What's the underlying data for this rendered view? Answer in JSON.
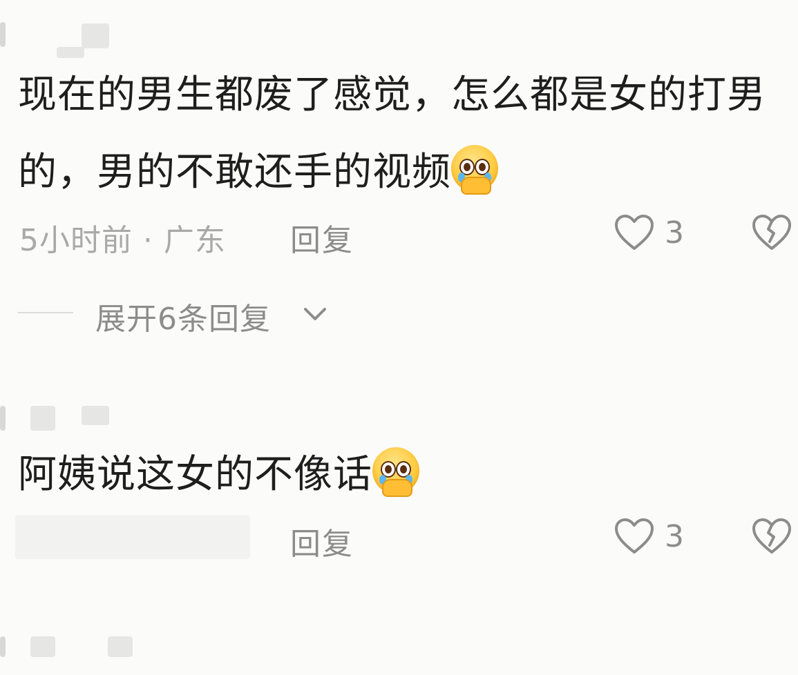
{
  "comments": [
    {
      "text": "现在的男生都废了感觉，怎么都是女的打男的，男的不敢还手的视频",
      "emoji": "pleading-crying-face",
      "time_location": "5小时前 · 广东",
      "reply_label": "回复",
      "like_count": "3",
      "expand_label": "展开6条回复"
    },
    {
      "text": "阿姨说这女的不像话",
      "emoji": "pleading-crying-face",
      "reply_label": "回复",
      "like_count": "3"
    }
  ],
  "colors": {
    "background": "#fbfbf9",
    "text": "#1e1e1e",
    "meta": "#a9a9a9",
    "action": "#8c8c8c"
  }
}
